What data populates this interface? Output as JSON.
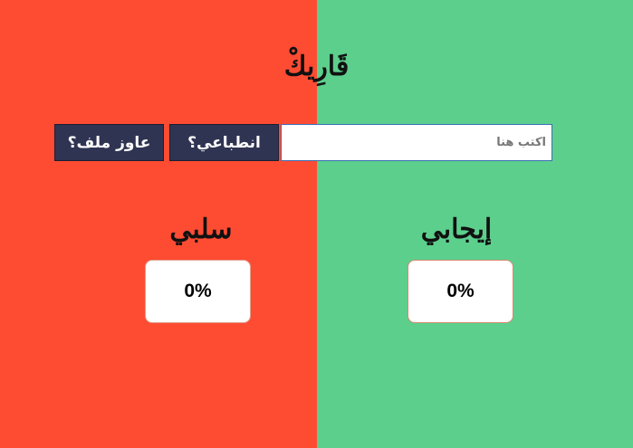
{
  "app": {
    "title": "قَارِيكْ"
  },
  "toolbar": {
    "file_button_label": "عاوز ملف؟",
    "impression_button_label": "انطباعي؟"
  },
  "input": {
    "placeholder": "اكتب هنا",
    "value": ""
  },
  "results": {
    "negative": {
      "label": "سلبي",
      "value": "0%"
    },
    "positive": {
      "label": "إيجابي",
      "value": "0%"
    }
  },
  "colors": {
    "negative_bg": "#fe4c33",
    "positive_bg": "#5ccf8d",
    "button_bg": "#2f3452"
  }
}
